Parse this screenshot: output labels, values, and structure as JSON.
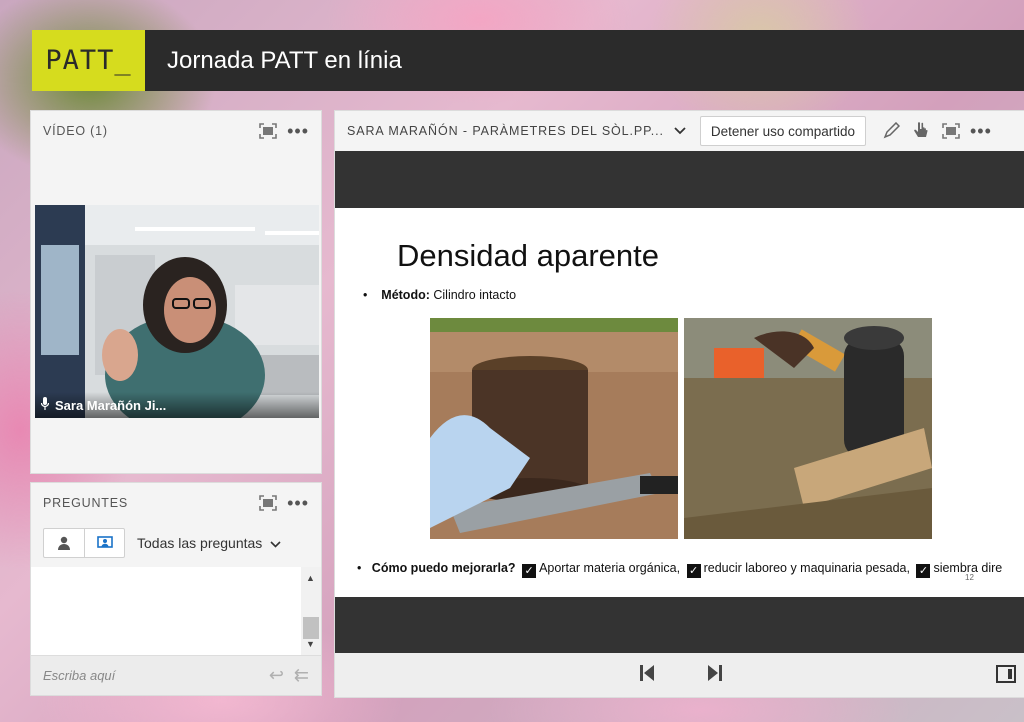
{
  "app": {
    "logo": "PATT_",
    "title": "Jornada PATT en línia"
  },
  "video_pod": {
    "title": "VÍDEO (1)",
    "participant_name": "Sara Marañón Ji...",
    "icons": [
      "fullscreen-icon",
      "more-icon",
      "microphone-icon"
    ]
  },
  "questions_pod": {
    "title": "PREGUNTES",
    "filter_label": "Todas las preguntas",
    "input_placeholder": "Escriba aquí",
    "icons": [
      "person-icon",
      "presenter-icon",
      "reply-icon",
      "reply-all-icon"
    ]
  },
  "share_pod": {
    "title": "SARA MARAÑÓN - PARÀMETRES DEL SÒL.PP...",
    "stop_sharing_label": "Detener uso compartido",
    "slide": {
      "title": "Densidad aparente",
      "method_label": "Método:",
      "method_value": "Cilindro intacto",
      "improve_label": "Cómo puedo mejorarla?",
      "improve_items": [
        "Aportar materia orgánica,",
        "reducir laboreo y maquinaria pesada,",
        "siembra dire"
      ],
      "page_number": "12"
    },
    "icons": [
      "annotate-icon",
      "pointer-icon",
      "fullscreen-icon",
      "more-icon",
      "prev-slide-icon",
      "next-slide-icon",
      "layout-icon"
    ]
  },
  "colors": {
    "accent": "#d6dc1e",
    "header_bar": "#2b2b2b",
    "pod_bg": "#f4f4f4",
    "share_band": "#333333"
  }
}
